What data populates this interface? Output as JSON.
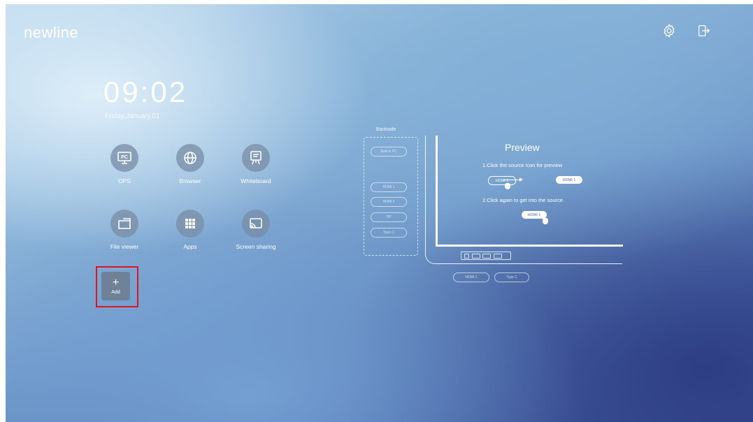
{
  "header": {
    "logo": "newline",
    "settings_icon": "gear-icon",
    "exit_icon": "exit-icon"
  },
  "clock": {
    "time": "09:02",
    "date": "Friday,January.01"
  },
  "apps": [
    {
      "label": "OPS",
      "icon": "pc-icon"
    },
    {
      "label": "Browser",
      "icon": "globe-icon"
    },
    {
      "label": "Whiteboard",
      "icon": "whiteboard-icon"
    },
    {
      "label": "File viewer",
      "icon": "folder-icon"
    },
    {
      "label": "Apps",
      "icon": "apps-grid-icon"
    },
    {
      "label": "Screen sharing",
      "icon": "screen-share-icon"
    }
  ],
  "add": {
    "symbol": "+",
    "label": "Add"
  },
  "diagram": {
    "backside_label": "Backside",
    "backside_ports": [
      "Built in PC",
      "HDMI 1",
      "HDMI 2",
      "DP",
      "Type C"
    ],
    "front_ports": [
      "HDMI 1",
      "Type C"
    ],
    "preview_title": "Preview",
    "step1": "1.Click the source icon for preview",
    "step2": "2.Click again to get into the source",
    "pill_outline": "HDMI 1",
    "pill_solid": "HDMI 1",
    "pill_second": "HDMI 1"
  },
  "colors": {
    "add_highlight": "#e0141e"
  }
}
